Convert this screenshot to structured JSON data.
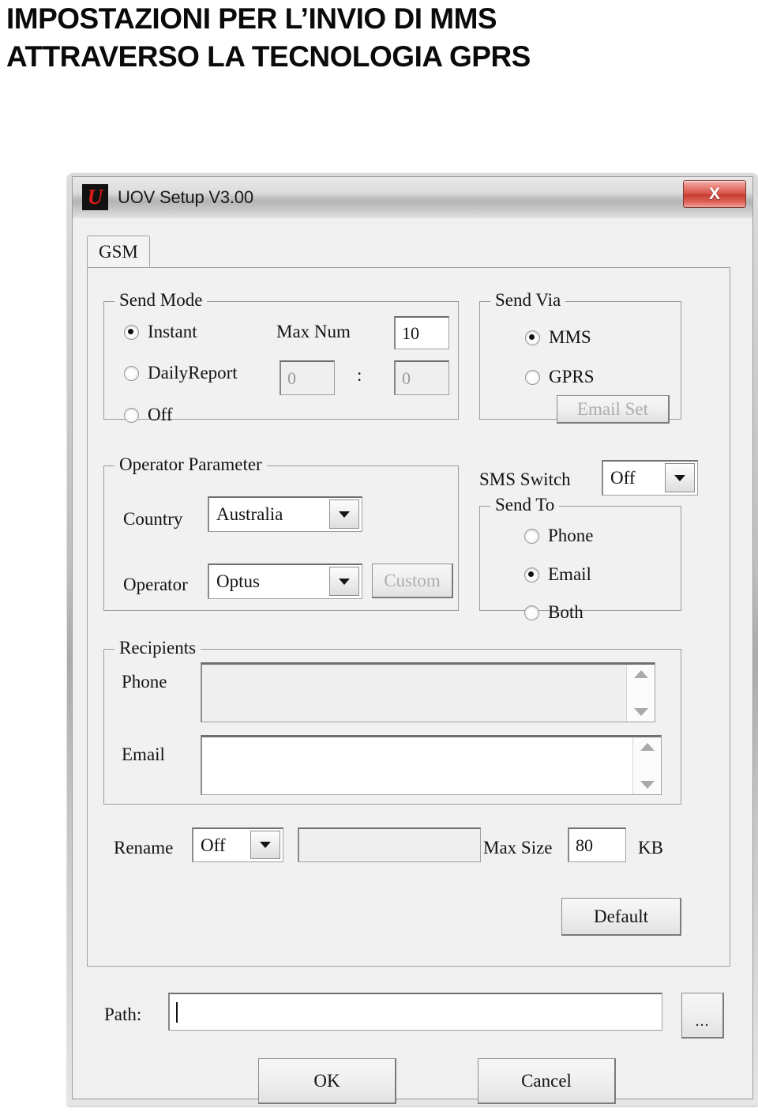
{
  "page": {
    "heading_line1": "IMPOSTAZIONI PER L’INVIO DI MMS",
    "heading_line2": "ATTRAVERSO LA TECNOLOGIA GPRS",
    "background_color": "#ffffff"
  },
  "window": {
    "title": "UOV Setup V3.00",
    "logo_glyph": "U",
    "logo_color": "#e01b18",
    "close_label": "X",
    "close_color": "#c33a30"
  },
  "tabs": [
    {
      "label": "GSM",
      "selected": true
    }
  ],
  "send_mode": {
    "legend": "Send Mode",
    "options": [
      {
        "label": "Instant",
        "checked": true
      },
      {
        "label": "DailyReport",
        "checked": false
      },
      {
        "label": "Off",
        "checked": false
      }
    ],
    "max_num_label": "Max Num",
    "max_num_value": "10",
    "hour_value": "0",
    "separator": ":",
    "minute_value": "0"
  },
  "send_via": {
    "legend": "Send Via",
    "options": [
      {
        "label": "MMS",
        "checked": true
      },
      {
        "label": "GPRS",
        "checked": false
      }
    ],
    "email_set_label": "Email Set",
    "email_set_enabled": false
  },
  "operator_parameter": {
    "legend": "Operator Parameter",
    "country_label": "Country",
    "country_value": "Australia",
    "operator_label": "Operator",
    "operator_value": "Optus",
    "custom_label": "Custom",
    "custom_enabled": false
  },
  "sms_switch": {
    "label": "SMS Switch",
    "value": "Off"
  },
  "send_to": {
    "legend": "Send To",
    "options": [
      {
        "label": "Phone",
        "checked": false
      },
      {
        "label": "Email",
        "checked": true
      },
      {
        "label": "Both",
        "checked": false
      }
    ]
  },
  "recipients": {
    "legend": "Recipients",
    "phone_label": "Phone",
    "phone_value": "",
    "phone_enabled": false,
    "email_label": "Email",
    "email_value": "",
    "email_enabled": true
  },
  "rename_row": {
    "rename_label": "Rename",
    "rename_value": "Off",
    "rename_text_value": "",
    "max_size_label": "Max Size",
    "max_size_value": "80",
    "max_size_unit": "KB"
  },
  "default_button": {
    "label": "Default"
  },
  "path_row": {
    "label": "Path:",
    "value": "",
    "browse_label": "..."
  },
  "footer": {
    "ok_label": "OK",
    "cancel_label": "Cancel"
  }
}
